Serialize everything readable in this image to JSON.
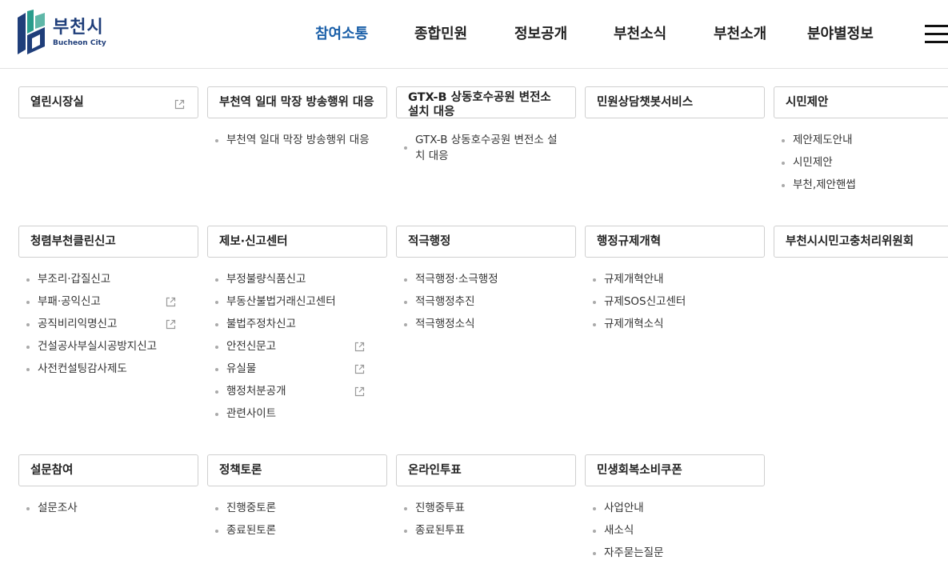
{
  "logo": {
    "name": "부천시",
    "sub": "Bucheon City"
  },
  "nav": {
    "items": [
      {
        "label": "참여소통",
        "active": true
      },
      {
        "label": "종합민원",
        "active": false
      },
      {
        "label": "정보공개",
        "active": false
      },
      {
        "label": "부천소식",
        "active": false
      },
      {
        "label": "부천소개",
        "active": false
      },
      {
        "label": "분야별정보",
        "active": false
      }
    ],
    "menu_icon": "hamburger-menu-icon"
  },
  "menu": [
    {
      "title": "열린시장실",
      "external": true,
      "items": []
    },
    {
      "title": "부천역 일대 막장 방송행위 대응",
      "external": false,
      "items": [
        {
          "label": "부천역 일대 막장 방송행위 대응",
          "external": false
        }
      ]
    },
    {
      "title": "GTX-B 상동호수공원 변전소 설치 대응",
      "external": false,
      "items": [
        {
          "label": "GTX-B 상동호수공원 변전소 설치 대응",
          "external": false
        }
      ]
    },
    {
      "title": "민원상담챗봇서비스",
      "external": false,
      "items": []
    },
    {
      "title": "시민제안",
      "external": false,
      "items": [
        {
          "label": "제안제도안내",
          "external": false
        },
        {
          "label": "시민제안",
          "external": false
        },
        {
          "label": "부천,제안핸썹",
          "external": false
        }
      ]
    },
    {
      "title": "청렴부천클린신고",
      "external": false,
      "items": [
        {
          "label": "부조리·갑질신고",
          "external": false
        },
        {
          "label": "부패·공익신고",
          "external": true
        },
        {
          "label": "공직비리익명신고",
          "external": true
        },
        {
          "label": "건설공사부실시공방지신고",
          "external": false
        },
        {
          "label": "사전컨설팅감사제도",
          "external": false
        }
      ]
    },
    {
      "title": "제보·신고센터",
      "external": false,
      "items": [
        {
          "label": "부정불량식품신고",
          "external": false
        },
        {
          "label": "부동산불법거래신고센터",
          "external": false
        },
        {
          "label": "불법주정차신고",
          "external": false
        },
        {
          "label": "안전신문고",
          "external": true
        },
        {
          "label": "유실물",
          "external": true
        },
        {
          "label": "행정처분공개",
          "external": true
        },
        {
          "label": "관련사이트",
          "external": false
        }
      ]
    },
    {
      "title": "적극행정",
      "external": false,
      "items": [
        {
          "label": "적극행정·소극행정",
          "external": false
        },
        {
          "label": "적극행정추진",
          "external": false
        },
        {
          "label": "적극행정소식",
          "external": false
        }
      ]
    },
    {
      "title": "행정규제개혁",
      "external": false,
      "items": [
        {
          "label": "규제개혁안내",
          "external": false
        },
        {
          "label": "규제SOS신고센터",
          "external": false
        },
        {
          "label": "규제개혁소식",
          "external": false
        }
      ]
    },
    {
      "title": "부천시시민고충처리위원회",
      "external": false,
      "items": []
    },
    {
      "title": "설문참여",
      "external": false,
      "items": [
        {
          "label": "설문조사",
          "external": false
        }
      ]
    },
    {
      "title": "정책토론",
      "external": false,
      "items": [
        {
          "label": "진행중토론",
          "external": false
        },
        {
          "label": "종료된토론",
          "external": false
        }
      ]
    },
    {
      "title": "온라인투표",
      "external": false,
      "items": [
        {
          "label": "진행중투표",
          "external": false
        },
        {
          "label": "종료된투표",
          "external": false
        }
      ]
    },
    {
      "title": "민생회복소비쿠폰",
      "external": false,
      "items": [
        {
          "label": "사업안내",
          "external": false
        },
        {
          "label": "새소식",
          "external": false
        },
        {
          "label": "자주묻는질문",
          "external": false
        }
      ]
    }
  ],
  "colors": {
    "brand": "#1f3e7a",
    "active": "#1a5fa8",
    "border": "#cfcfcf"
  }
}
